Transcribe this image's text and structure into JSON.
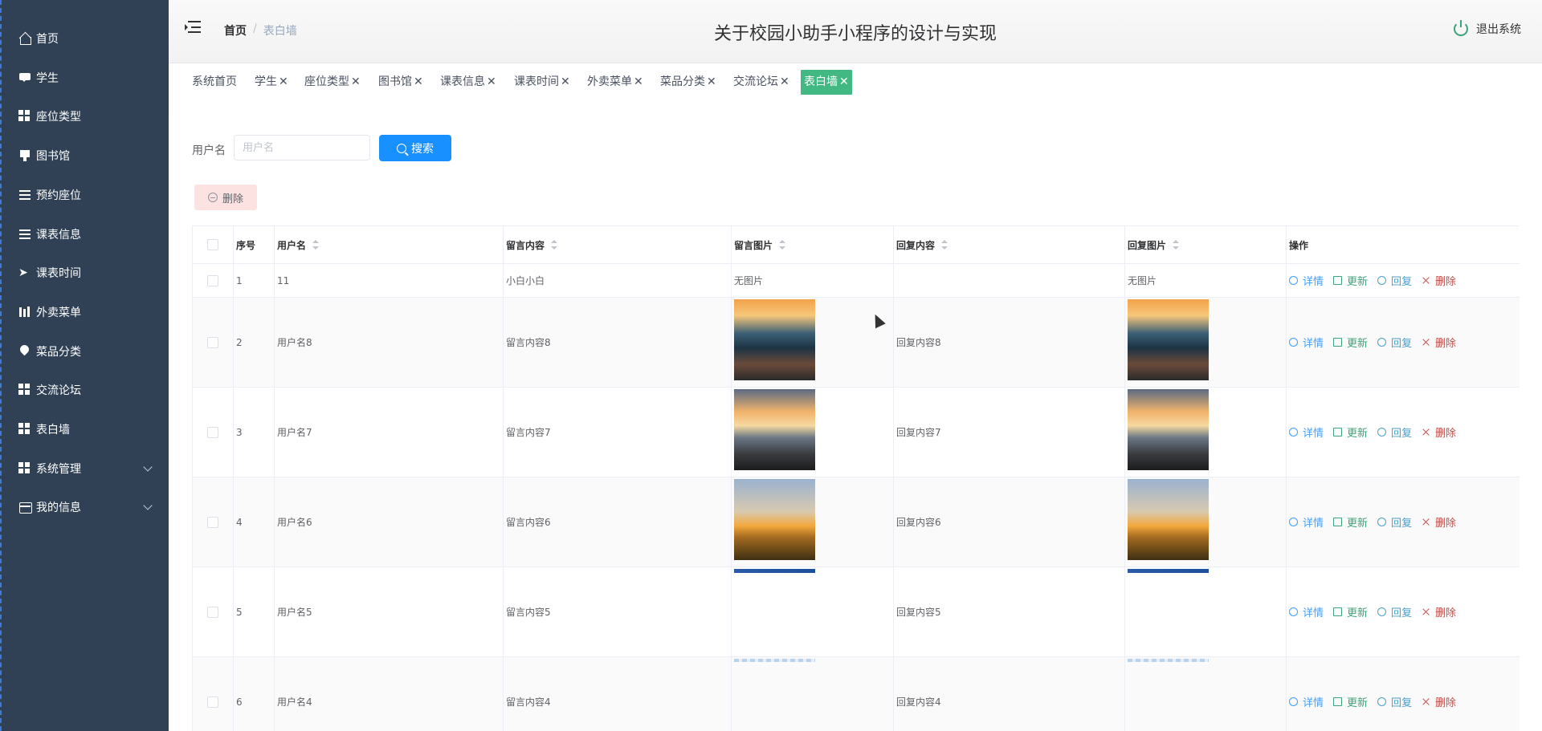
{
  "app": {
    "title": "关于校园小助手小程序的设计与实现",
    "logout_label": "退出系统"
  },
  "breadcrumb": {
    "home": "首页",
    "sep": "/",
    "current": "表白墙"
  },
  "sidebar": {
    "items": [
      {
        "label": "首页",
        "icon": "home-icon"
      },
      {
        "label": "学生",
        "icon": "chat-icon"
      },
      {
        "label": "座位类型",
        "icon": "grid-icon"
      },
      {
        "label": "图书馆",
        "icon": "board-icon"
      },
      {
        "label": "预约座位",
        "icon": "list-icon"
      },
      {
        "label": "课表信息",
        "icon": "list-icon"
      },
      {
        "label": "课表时间",
        "icon": "send-icon"
      },
      {
        "label": "外卖菜单",
        "icon": "bar-chart-icon"
      },
      {
        "label": "菜品分类",
        "icon": "location-icon"
      },
      {
        "label": "交流论坛",
        "icon": "grid-icon"
      },
      {
        "label": "表白墙",
        "icon": "grid-icon"
      },
      {
        "label": "系统管理",
        "icon": "grid-icon"
      },
      {
        "label": "我的信息",
        "icon": "card-icon"
      }
    ]
  },
  "tags": [
    {
      "label": "系统首页",
      "closable": false
    },
    {
      "label": "学生",
      "closable": true
    },
    {
      "label": "座位类型",
      "closable": true
    },
    {
      "label": "图书馆",
      "closable": true
    },
    {
      "label": "课表信息",
      "closable": true
    },
    {
      "label": "课表时间",
      "closable": true
    },
    {
      "label": "外卖菜单",
      "closable": true
    },
    {
      "label": "菜品分类",
      "closable": true
    },
    {
      "label": "交流论坛",
      "closable": true
    },
    {
      "label": "表白墙",
      "closable": true,
      "active": true
    }
  ],
  "tag_close_glyph": "✕",
  "search": {
    "label": "用户名",
    "placeholder": "用户名",
    "value": "",
    "button_label": "搜索"
  },
  "toolbar": {
    "delete_label": "删除"
  },
  "table": {
    "headers": [
      "序号",
      "用户名",
      "留言内容",
      "留言图片",
      "回复内容",
      "回复图片",
      "操作"
    ],
    "rows": [
      {
        "index": "1",
        "username": "11",
        "content": "小白小白",
        "image_text": "无图片",
        "reply": "",
        "reply_image_text": "无图片"
      },
      {
        "index": "2",
        "username": "用户名8",
        "content": "留言内容8",
        "image_text": "",
        "reply": "回复内容8",
        "reply_image_text": ""
      },
      {
        "index": "3",
        "username": "用户名7",
        "content": "留言内容7",
        "image_text": "",
        "reply": "回复内容7",
        "reply_image_text": ""
      },
      {
        "index": "4",
        "username": "用户名6",
        "content": "留言内容6",
        "image_text": "",
        "reply": "回复内容6",
        "reply_image_text": ""
      },
      {
        "index": "5",
        "username": "用户名5",
        "content": "留言内容5",
        "image_text": "",
        "reply": "回复内容5",
        "reply_image_text": ""
      },
      {
        "index": "6",
        "username": "用户名4",
        "content": "留言内容4",
        "image_text": "",
        "reply": "回复内容4",
        "reply_image_text": ""
      }
    ],
    "actions": {
      "view": "详情",
      "edit": "更新",
      "reply": "回复",
      "delete": "删除"
    }
  },
  "colors": {
    "sidebar_bg": "#304156",
    "active_tag": "#42b983",
    "primary": "#1890ff",
    "danger_light": "#fde2e2"
  }
}
